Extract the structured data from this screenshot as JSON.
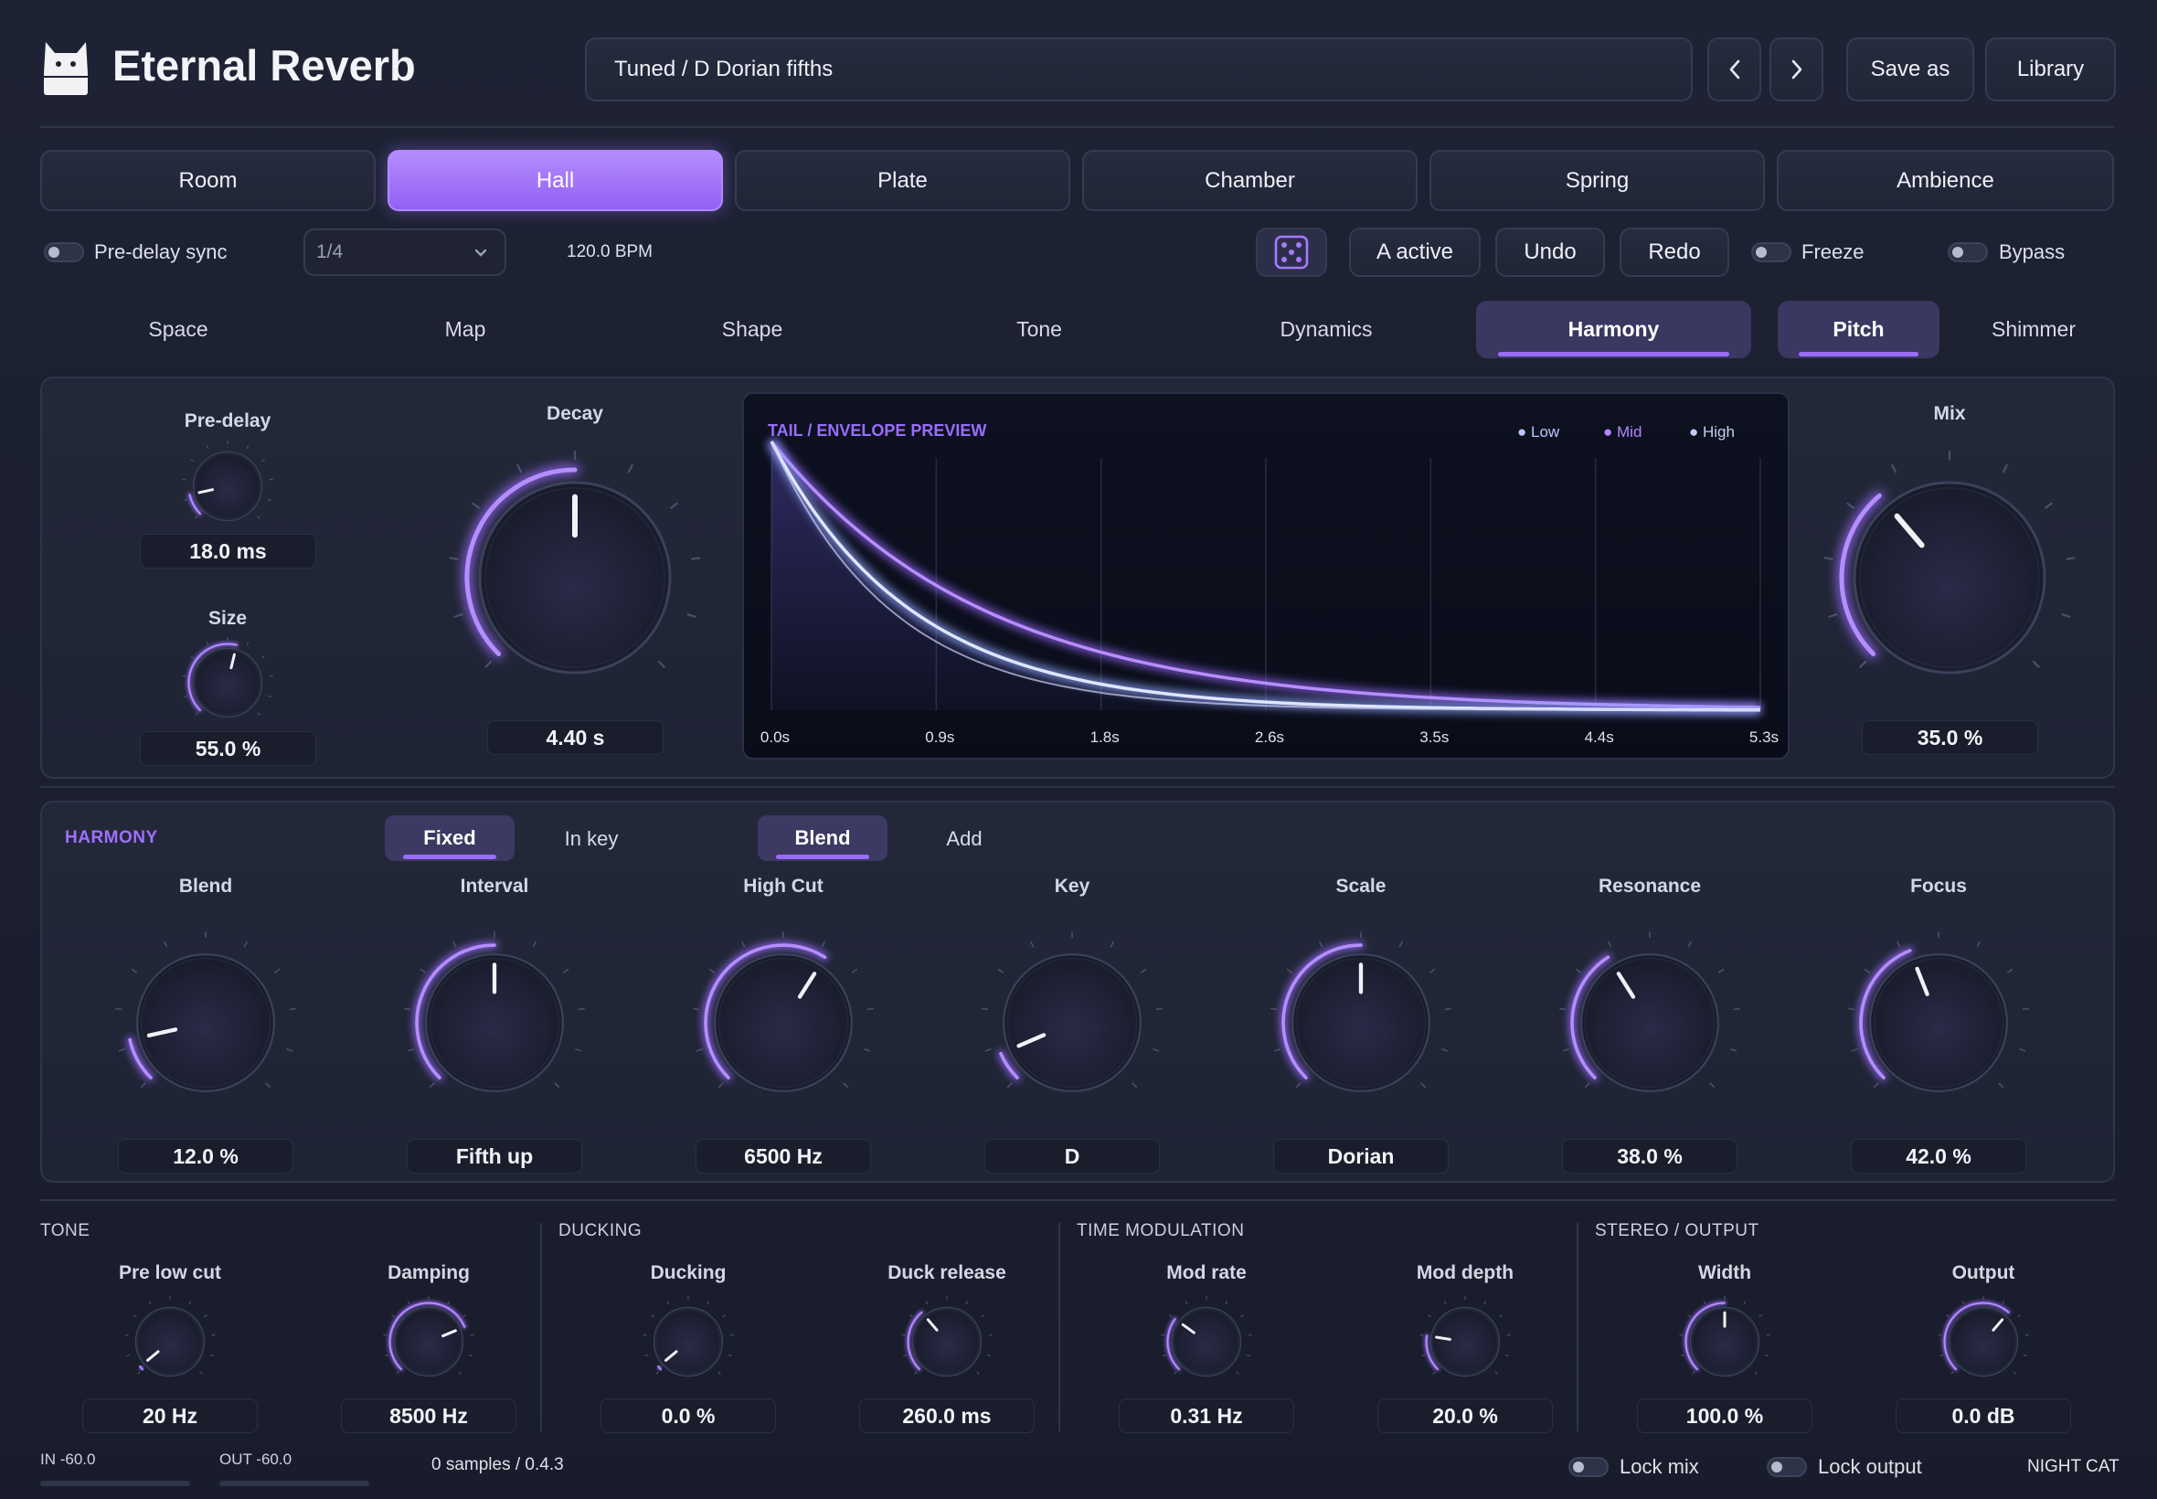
{
  "header": {
    "app_title": "Eternal Reverb",
    "preset_name": "Tuned / D Dorian fifths",
    "prev_icon": "chevron-left-icon",
    "next_icon": "chevron-right-icon",
    "save_as_label": "Save as",
    "library_label": "Library"
  },
  "reverb_types": {
    "items": [
      "Room",
      "Hall",
      "Plate",
      "Chamber",
      "Spring",
      "Ambience"
    ],
    "active": "Hall"
  },
  "controls_row": {
    "predelay_sync_label": "Pre-delay sync",
    "sync_division": "1/4",
    "bpm": "120.0 BPM",
    "randomize_icon": "dice-icon",
    "ab_label": "A active",
    "undo_label": "Undo",
    "redo_label": "Redo",
    "freeze_label": "Freeze",
    "bypass_label": "Bypass"
  },
  "page_tabs": {
    "items": [
      "Space",
      "Map",
      "Shape",
      "Tone",
      "Dynamics",
      "Harmony",
      "Pitch",
      "Shimmer"
    ],
    "active": [
      "Harmony",
      "Pitch"
    ]
  },
  "main": {
    "predelay": {
      "label": "Pre-delay",
      "value": "18.0 ms",
      "level": 0.12
    },
    "size": {
      "label": "Size",
      "value": "55.0 %",
      "level": 0.55
    },
    "decay": {
      "label": "Decay",
      "value": "4.40 s",
      "level": 0.5
    },
    "mix": {
      "label": "Mix",
      "value": "35.0 %",
      "level": 0.35
    },
    "preview": {
      "title": "TAIL / ENVELOPE PREVIEW",
      "legend": [
        "Low",
        "Mid",
        "High"
      ],
      "x_ticks": [
        "0.0s",
        "0.9s",
        "1.8s",
        "2.6s",
        "3.5s",
        "4.4s",
        "5.3s"
      ]
    }
  },
  "harmony": {
    "section_title": "HARMONY",
    "mode_options": [
      "Fixed",
      "In key"
    ],
    "mode_active": "Fixed",
    "combine_options": [
      "Blend",
      "Add"
    ],
    "combine_active": "Blend",
    "knobs": [
      {
        "label": "Blend",
        "value": "12.0 %",
        "level": 0.12
      },
      {
        "label": "Interval",
        "value": "Fifth up",
        "level": 0.5
      },
      {
        "label": "High Cut",
        "value": "6500 Hz",
        "level": 0.62
      },
      {
        "label": "Key",
        "value": "D",
        "level": 0.08
      },
      {
        "label": "Scale",
        "value": "Dorian",
        "level": 0.5
      },
      {
        "label": "Resonance",
        "value": "38.0 %",
        "level": 0.38
      },
      {
        "label": "Focus",
        "value": "42.0 %",
        "level": 0.42
      }
    ]
  },
  "bottom": {
    "sections": [
      {
        "title": "TONE",
        "knobs": [
          {
            "label": "Pre low cut",
            "value": "20 Hz",
            "level": 0.0
          },
          {
            "label": "Damping",
            "value": "8500 Hz",
            "level": 0.75
          }
        ]
      },
      {
        "title": "DUCKING",
        "knobs": [
          {
            "label": "Ducking",
            "value": "0.0 %",
            "level": 0.0
          },
          {
            "label": "Duck release",
            "value": "260.0 ms",
            "level": 0.35
          }
        ]
      },
      {
        "title": "TIME MODULATION",
        "knobs": [
          {
            "label": "Mod rate",
            "value": "0.31 Hz",
            "level": 0.3
          },
          {
            "label": "Mod depth",
            "value": "20.0 %",
            "level": 0.2
          }
        ]
      },
      {
        "title": "STEREO / OUTPUT",
        "knobs": [
          {
            "label": "Width",
            "value": "100.0 %",
            "level": 0.5
          },
          {
            "label": "Output",
            "value": "0.0 dB",
            "level": 0.65
          }
        ]
      }
    ]
  },
  "footer": {
    "in_meter": "IN -60.0",
    "out_meter": "OUT -60.0",
    "latency": "0 samples / 0.4.3",
    "lock_mix_label": "Lock mix",
    "lock_output_label": "Lock output",
    "brand": "NIGHT CAT"
  },
  "colors": {
    "accent": "#9a6cff",
    "background": "#1c2030",
    "panel": "#232839"
  }
}
